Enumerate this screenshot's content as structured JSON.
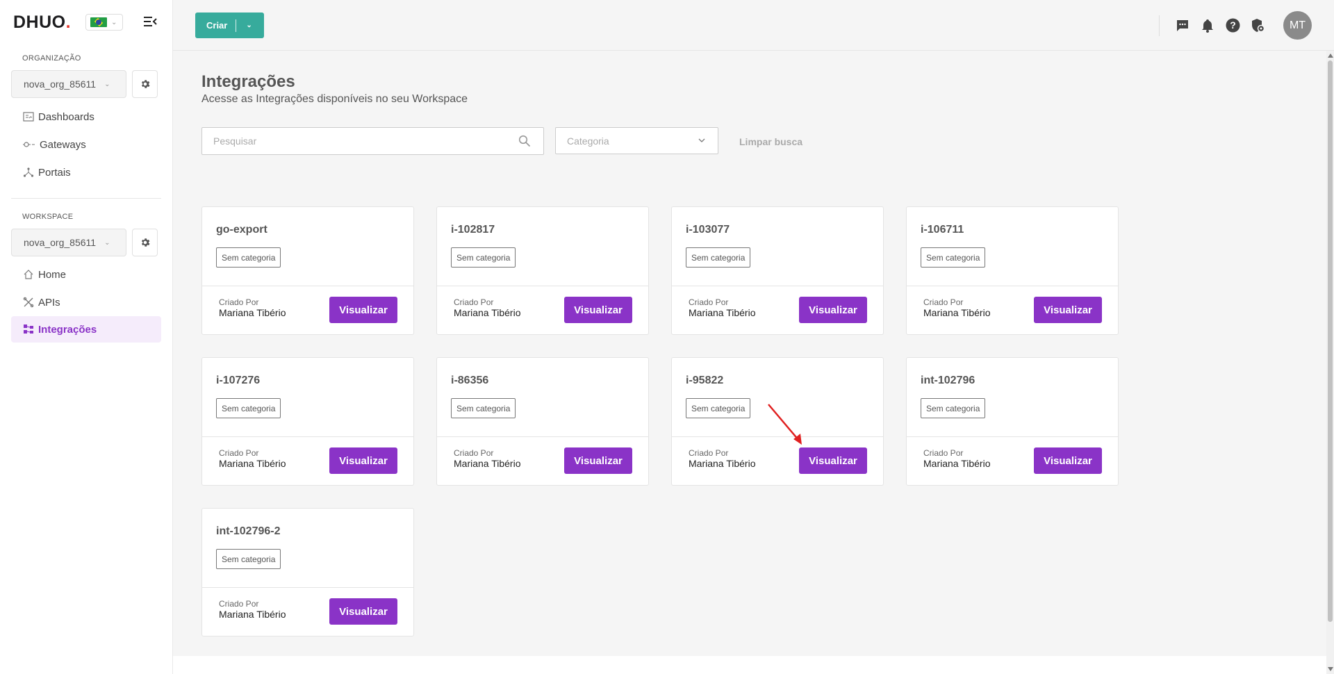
{
  "sidebar": {
    "logo_text": "DHUO",
    "logo_dot": ".",
    "org_label": "ORGANIZAÇÃO",
    "org_value": "nova_org_85611",
    "org_nav": [
      {
        "label": "Dashboards",
        "icon": "dashboard-icon"
      },
      {
        "label": "Gateways",
        "icon": "gateway-icon"
      },
      {
        "label": "Portais",
        "icon": "portal-icon"
      }
    ],
    "workspace_label": "WORKSPACE",
    "workspace_value": "nova_org_85611",
    "ws_nav": [
      {
        "label": "Home",
        "icon": "home-icon"
      },
      {
        "label": "APIs",
        "icon": "api-icon"
      },
      {
        "label": "Integrações",
        "icon": "integrations-icon",
        "active": true
      }
    ]
  },
  "topbar": {
    "create_label": "Criar",
    "avatar_initials": "MT"
  },
  "page": {
    "title": "Integrações",
    "subtitle": "Acesse as Integrações disponíveis no seu Workspace",
    "search_placeholder": "Pesquisar",
    "category_placeholder": "Categoria",
    "clear_label": "Limpar busca"
  },
  "cards": [
    {
      "name": "go-export",
      "category": "Sem categoria",
      "created_label": "Criado Por",
      "created_by": "Mariana Tibério",
      "button": "Visualizar"
    },
    {
      "name": "i-102817",
      "category": "Sem categoria",
      "created_label": "Criado Por",
      "created_by": "Mariana Tibério",
      "button": "Visualizar"
    },
    {
      "name": "i-103077",
      "category": "Sem categoria",
      "created_label": "Criado Por",
      "created_by": "Mariana Tibério",
      "button": "Visualizar"
    },
    {
      "name": "i-106711",
      "category": "Sem categoria",
      "created_label": "Criado Por",
      "created_by": "Mariana Tibério",
      "button": "Visualizar"
    },
    {
      "name": "i-107276",
      "category": "Sem categoria",
      "created_label": "Criado Por",
      "created_by": "Mariana Tibério",
      "button": "Visualizar"
    },
    {
      "name": "i-86356",
      "category": "Sem categoria",
      "created_label": "Criado Por",
      "created_by": "Mariana Tibério",
      "button": "Visualizar"
    },
    {
      "name": "i-95822",
      "category": "Sem categoria",
      "created_label": "Criado Por",
      "created_by": "Mariana Tibério",
      "button": "Visualizar"
    },
    {
      "name": "int-102796",
      "category": "Sem categoria",
      "created_label": "Criado Por",
      "created_by": "Mariana Tibério",
      "button": "Visualizar"
    },
    {
      "name": "int-102796-2",
      "category": "Sem categoria",
      "created_label": "Criado Por",
      "created_by": "Mariana Tibério",
      "button": "Visualizar"
    }
  ],
  "colors": {
    "primary": "#8a33c7",
    "create_button": "#37ab9c",
    "active_nav_bg": "#f5ecfb",
    "annotation_arrow": "#e02020"
  }
}
